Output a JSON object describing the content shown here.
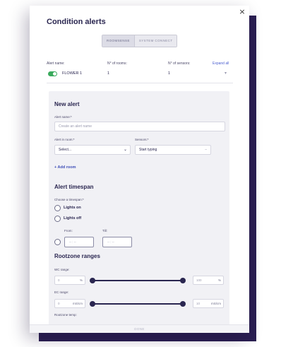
{
  "dialog": {
    "title": "Condition alerts",
    "close_label": "×"
  },
  "tabs": [
    {
      "label": "ROOMSENSE",
      "active": true
    },
    {
      "label": "SYSTEM CONNECT",
      "active": false
    }
  ],
  "table": {
    "headers": {
      "alert_name": "Alert name:",
      "rooms": "N° of rooms:",
      "sensors": "N° of sensors:",
      "expand_all": "Expand all"
    },
    "rows": [
      {
        "enabled": true,
        "name": "FLOWER 1",
        "rooms": "1",
        "sensors": "1",
        "chevron": "▾"
      }
    ]
  },
  "new_alert": {
    "heading": "New alert",
    "alert_name_label": "Alert name:*",
    "alert_name_placeholder": "Create an alert name",
    "room_label": "Alert in room:*",
    "room_value": "Select...",
    "room_chevron": "⌄",
    "sensors_label": "Sensors:*",
    "sensors_value": "Start typing",
    "sensors_tail": "–",
    "add_room_label": "+ Add room"
  },
  "timespan": {
    "heading": "Alert timespan",
    "choose_label": "Choose a timespan:*",
    "options": [
      "Lights on",
      "Lights off"
    ],
    "from_label": "From:",
    "till_label": "Till:",
    "from_value": "-- : --",
    "till_value": "-- : --"
  },
  "rootzone": {
    "heading": "Rootzone ranges",
    "wc": {
      "label": "WC range:",
      "min": "0",
      "max": "100",
      "unit": "%"
    },
    "ec": {
      "label": "EC range:",
      "min": "0",
      "max": "10",
      "unit": "mS/cm"
    },
    "temp_label": "Rootzone temp:"
  },
  "footer": {
    "label": "DONE"
  },
  "colors": {
    "accent": "#2a2650",
    "toggle_on": "#3aaa5c",
    "link": "#4c5fd0",
    "backdrop": "#2b1f52"
  }
}
